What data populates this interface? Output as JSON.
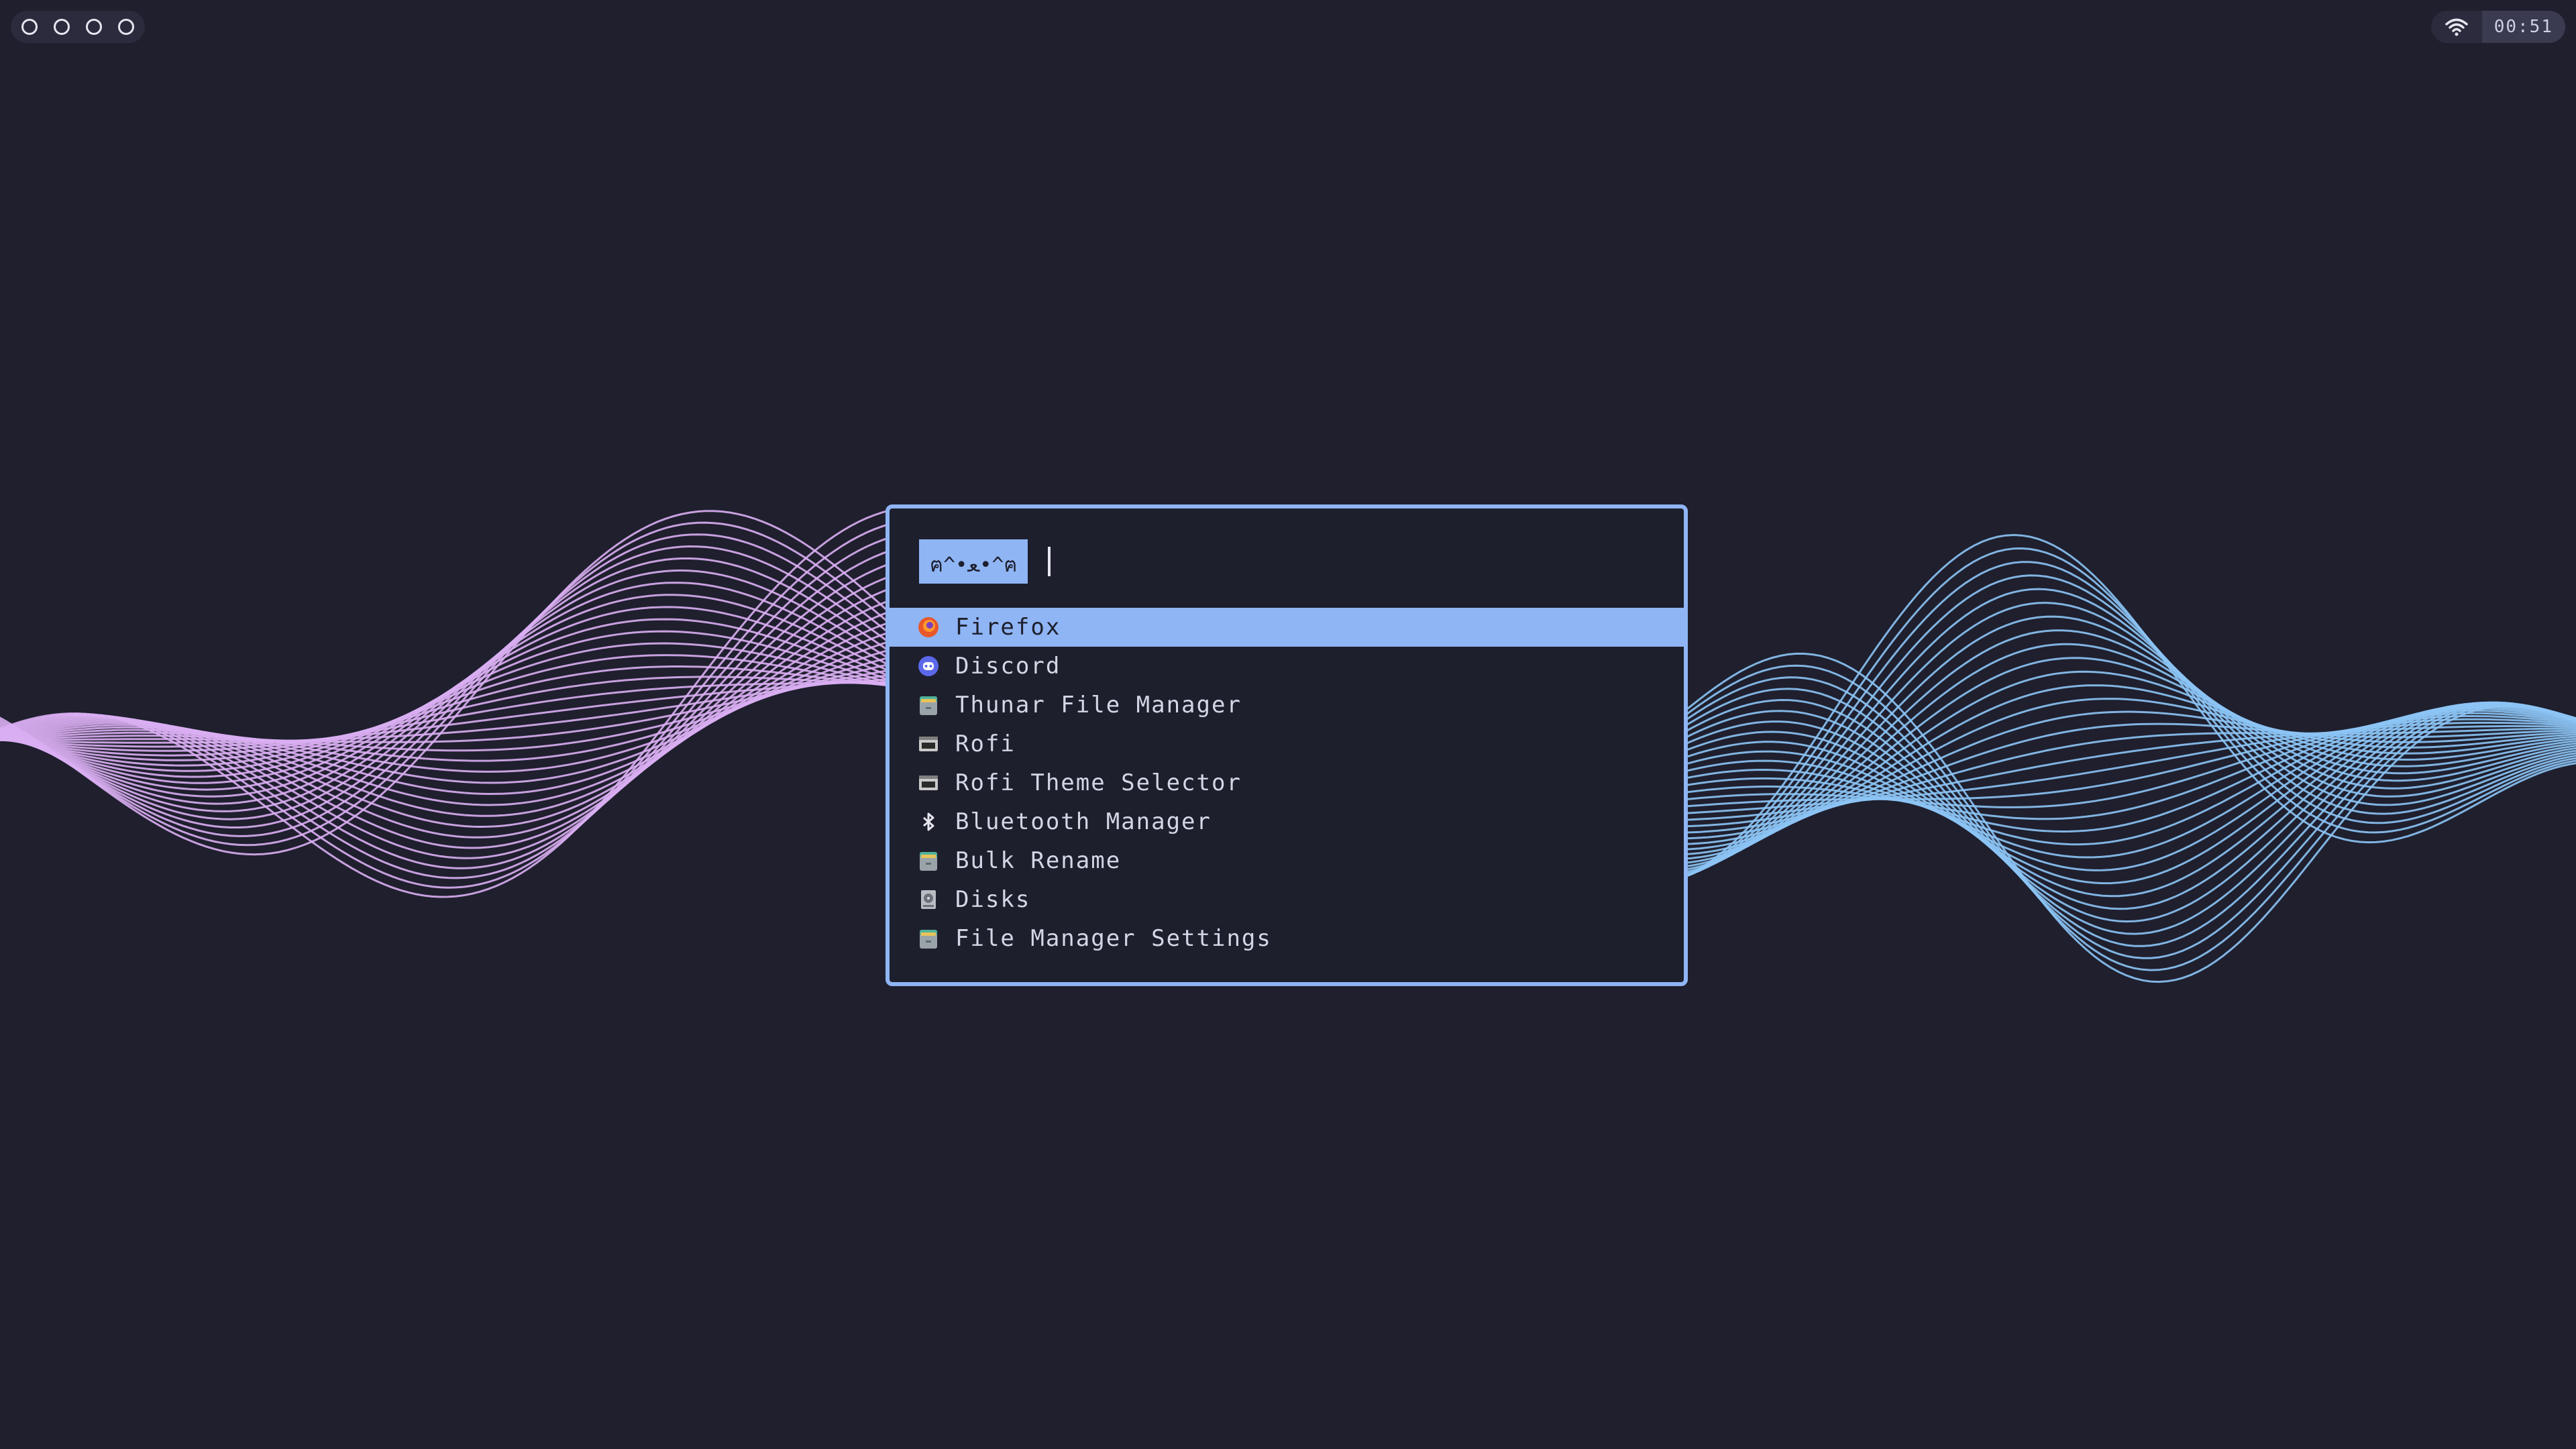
{
  "topbar": {
    "workspaces": [
      {
        "icon": "circle-icon"
      },
      {
        "icon": "circle-icon"
      },
      {
        "icon": "circle-icon"
      },
      {
        "icon": "circle-icon"
      }
    ],
    "wifi_icon": "wifi-icon",
    "clock": "00:51"
  },
  "launcher": {
    "prompt": "ฅ^•ﻌ•^ฅ",
    "input_value": "",
    "items": [
      {
        "label": "Firefox",
        "icon": "firefox-icon",
        "selected": true
      },
      {
        "label": "Discord",
        "icon": "discord-icon",
        "selected": false
      },
      {
        "label": "Thunar File Manager",
        "icon": "file-cabinet-icon",
        "selected": false
      },
      {
        "label": "Rofi",
        "icon": "rofi-icon",
        "selected": false
      },
      {
        "label": "Rofi Theme Selector",
        "icon": "rofi-icon",
        "selected": false
      },
      {
        "label": "Bluetooth Manager",
        "icon": "bluetooth-icon",
        "selected": false
      },
      {
        "label": "Bulk Rename",
        "icon": "file-cabinet-icon",
        "selected": false
      },
      {
        "label": "Disks",
        "icon": "disk-icon",
        "selected": false
      },
      {
        "label": "File Manager Settings",
        "icon": "file-cabinet-icon",
        "selected": false
      }
    ]
  },
  "colors": {
    "background": "#1f1f2e",
    "accent": "#8fb5f5",
    "wave_left": "#d9aef2",
    "wave_right": "#8cc4f5"
  }
}
